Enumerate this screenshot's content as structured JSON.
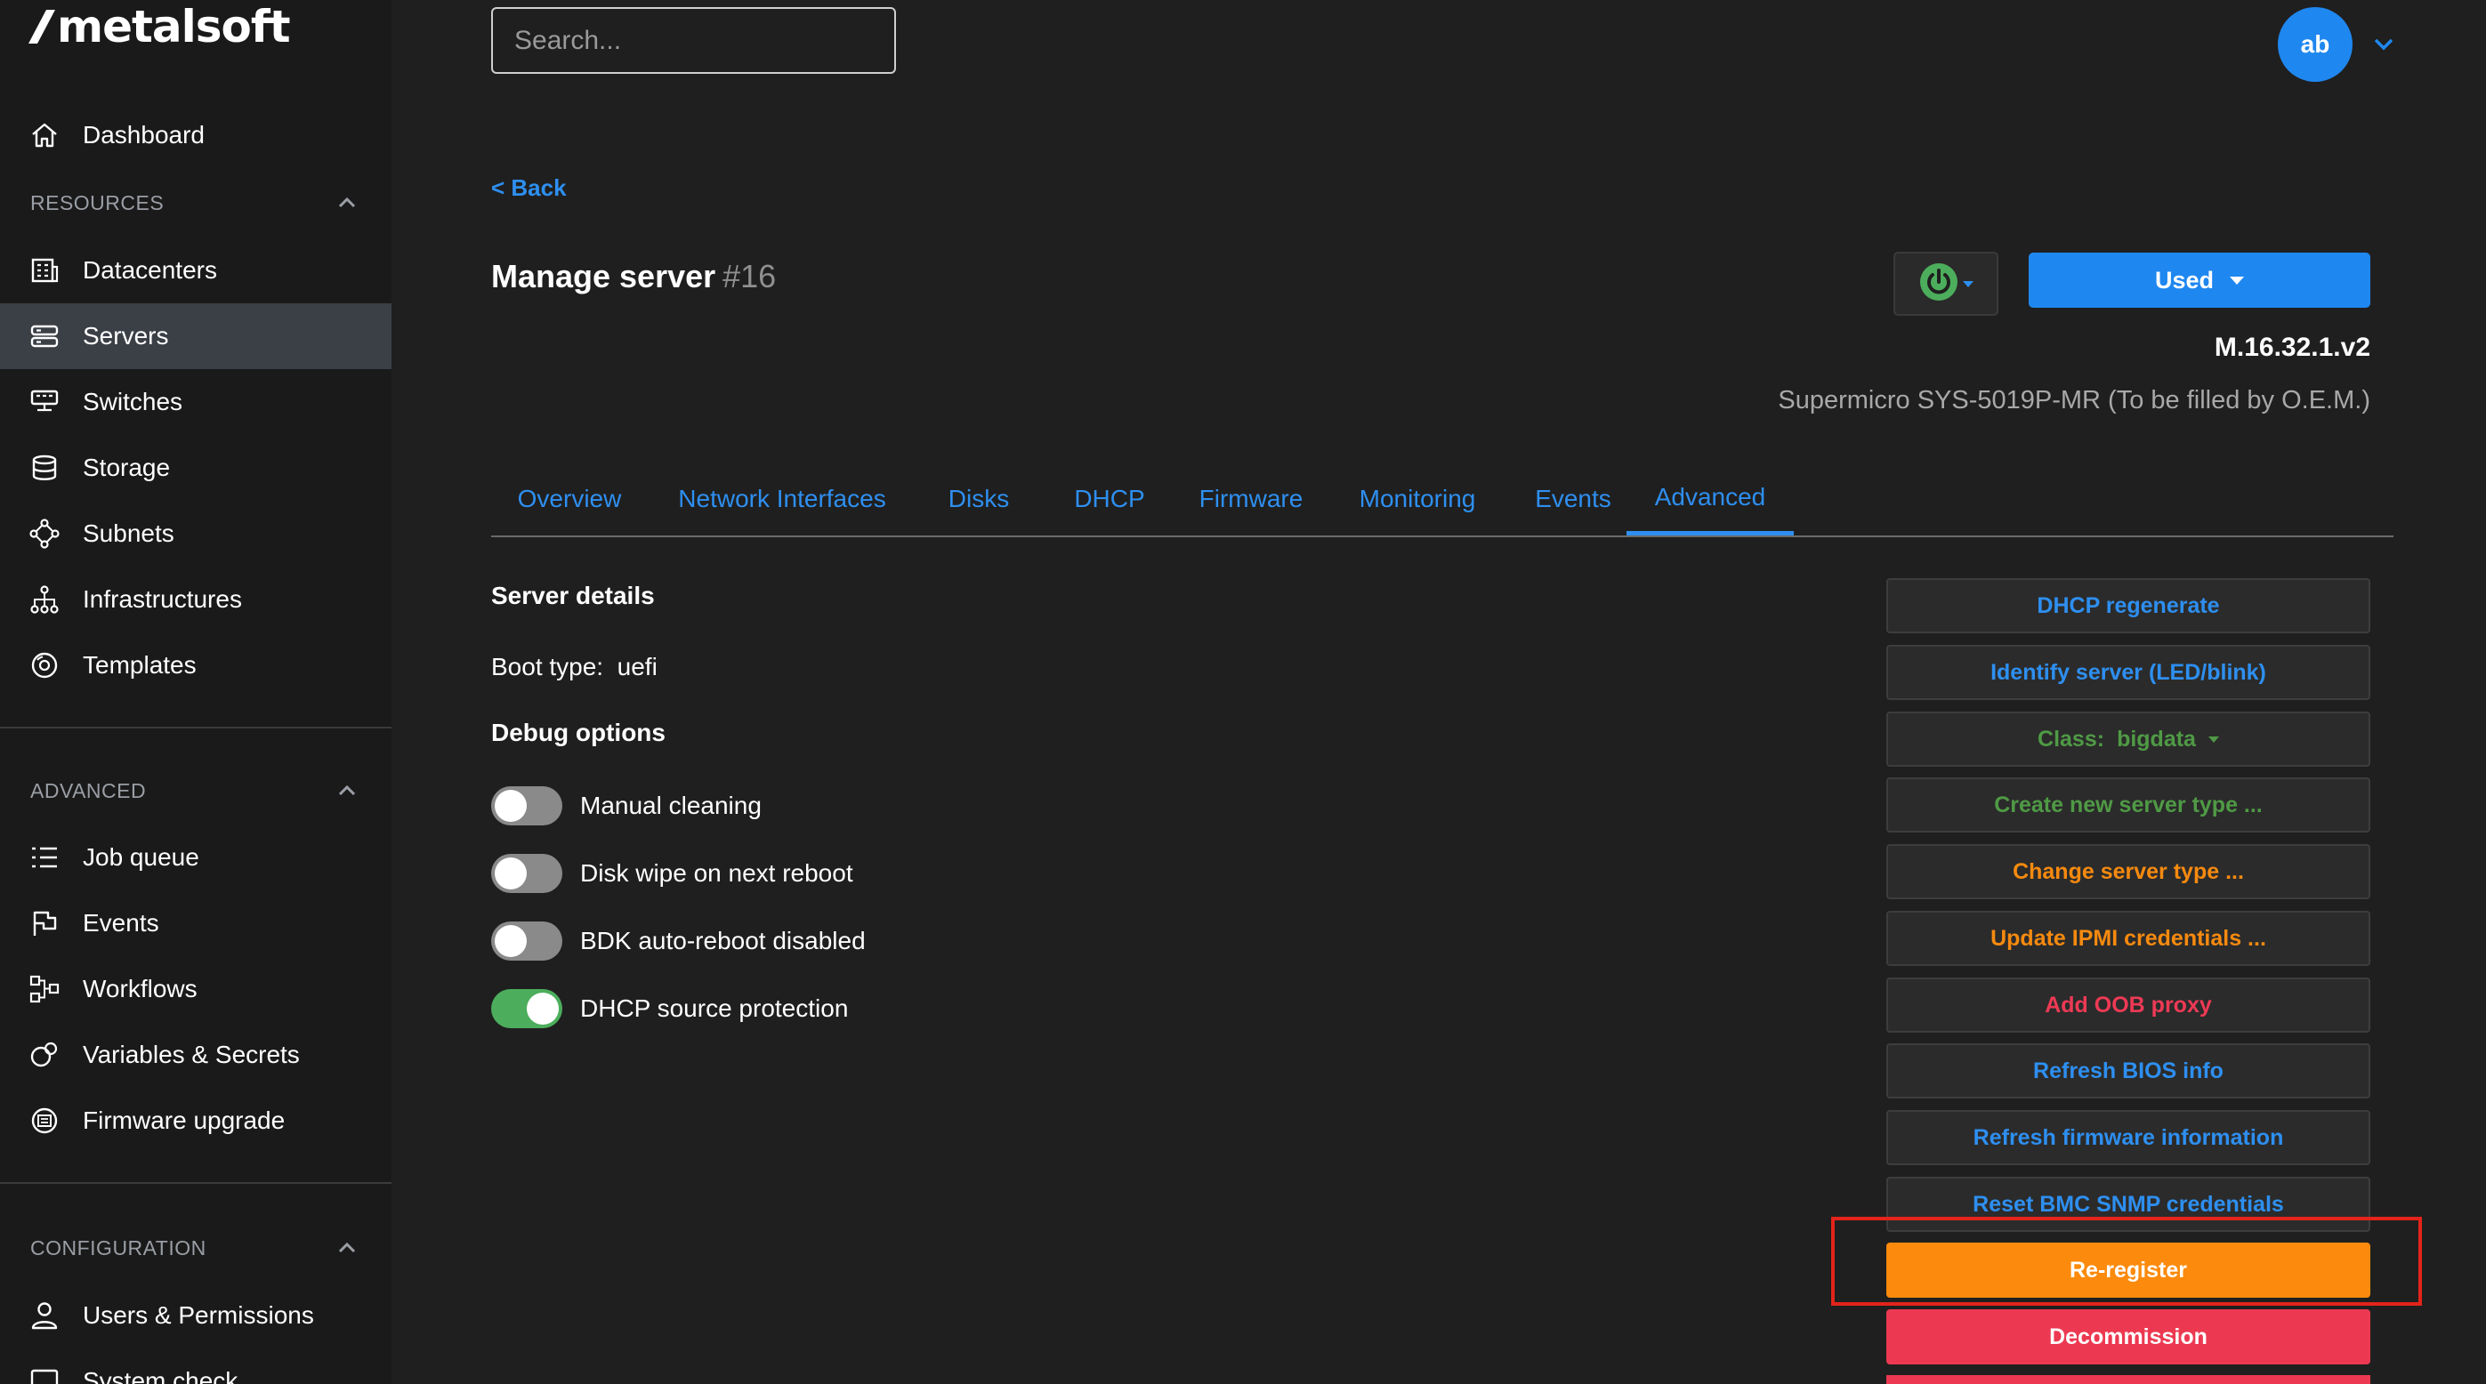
{
  "app": {
    "logo_text": "metalsoft"
  },
  "search": {
    "placeholder": "Search..."
  },
  "user": {
    "initials": "ab"
  },
  "sidebar": {
    "dashboard": "Dashboard",
    "resources_title": "RESOURCES",
    "resources": [
      "Datacenters",
      "Servers",
      "Switches",
      "Storage",
      "Subnets",
      "Infrastructures",
      "Templates"
    ],
    "advanced_title": "ADVANCED",
    "advanced": [
      "Job queue",
      "Events",
      "Workflows",
      "Variables & Secrets",
      "Firmware upgrade"
    ],
    "configuration_title": "CONFIGURATION",
    "configuration": [
      "Users & Permissions",
      "System check"
    ]
  },
  "header": {
    "back": "< Back",
    "title": "Manage server",
    "server_id": "#16",
    "status": "Used",
    "server_code": "M.16.32.1.v2",
    "server_model": "Supermicro SYS-5019P-MR (To be filled by O.E.M.)"
  },
  "tabs": [
    "Overview",
    "Network Interfaces",
    "Disks",
    "DHCP",
    "Firmware",
    "Monitoring",
    "Events",
    "Advanced"
  ],
  "details": {
    "server_details_title": "Server details",
    "boot_type_label": "Boot type:",
    "boot_type_value": "uefi",
    "debug_title": "Debug options",
    "toggles": [
      {
        "label": "Manual cleaning",
        "on": false
      },
      {
        "label": "Disk wipe on next reboot",
        "on": false
      },
      {
        "label": "BDK auto-reboot disabled",
        "on": false
      },
      {
        "label": "DHCP source protection",
        "on": true
      }
    ]
  },
  "actions": {
    "dhcp_regenerate": "DHCP regenerate",
    "identify_server": "Identify server (LED/blink)",
    "class_label": "Class:",
    "class_value": "bigdata",
    "create_server_type": "Create new server type ...",
    "change_server_type": "Change server type ...",
    "update_ipmi": "Update IPMI credentials ...",
    "add_oob_proxy": "Add OOB proxy",
    "refresh_bios": "Refresh BIOS info",
    "refresh_firmware": "Refresh firmware information",
    "reset_bmc_snmp": "Reset BMC SNMP credentials",
    "reregister": "Re-register",
    "decommission": "Decommission"
  },
  "colors": {
    "accent_blue": "#1f87f0",
    "link_blue": "#2e8ff0",
    "orange": "#fc8a0c",
    "red": "#ec3951",
    "green": "#4cae5c",
    "highlight": "#e3241b"
  }
}
